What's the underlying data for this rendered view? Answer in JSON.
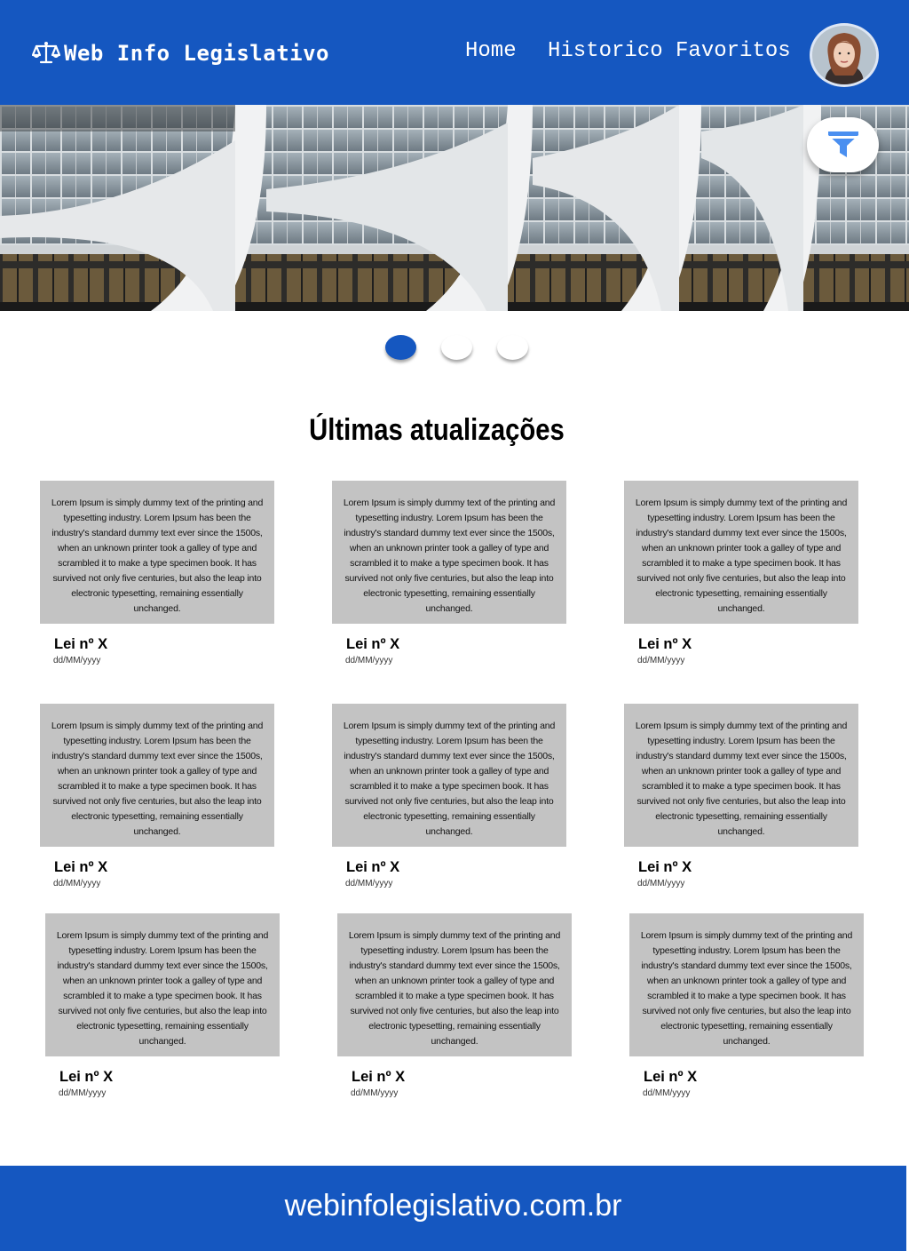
{
  "header": {
    "title": "Web Info Legislativo",
    "logo_icon": "scales-icon",
    "nav": {
      "home": "Home",
      "history": "Historico",
      "favorites": "Favoritos"
    },
    "avatar_icon": "user-avatar",
    "bg_color": "#1557c0"
  },
  "hero": {
    "filter_icon": "filter-icon"
  },
  "carousel": {
    "active_index": 0,
    "count": 3
  },
  "section": {
    "title": "Últimas atualizações"
  },
  "cards": [
    {
      "text": "Lorem Ipsum is simply dummy text of the printing and typesetting industry. Lorem Ipsum has been the industry's standard dummy text ever since the 1500s, when an unknown printer took a galley of type and scrambled it to make a type specimen book. It has survived not only five centuries, but also the leap into electronic typesetting, remaining essentially unchanged.",
      "title": "Lei nº X",
      "date": "dd/MM/yyyy"
    },
    {
      "text": "Lorem Ipsum is simply dummy text of the printing and typesetting industry. Lorem Ipsum has been the industry's standard dummy text ever since the 1500s, when an unknown printer took a galley of type and scrambled it to make a type specimen book. It has survived not only five centuries, but also the leap into electronic typesetting, remaining essentially unchanged.",
      "title": "Lei nº X",
      "date": "dd/MM/yyyy"
    },
    {
      "text": "Lorem Ipsum is simply dummy text of the printing and typesetting industry. Lorem Ipsum has been the industry's standard dummy text ever since the 1500s, when an unknown printer took a galley of type and scrambled it to make a type specimen book. It has survived not only five centuries, but also the leap into electronic typesetting, remaining essentially unchanged.",
      "title": "Lei nº X",
      "date": "dd/MM/yyyy"
    },
    {
      "text": "Lorem Ipsum is simply dummy text of the printing and typesetting industry. Lorem Ipsum has been the industry's standard dummy text ever since the 1500s, when an unknown printer took a galley of type and scrambled it to make a type specimen book. It has survived not only five centuries, but also the leap into electronic typesetting, remaining essentially unchanged.",
      "title": "Lei nº X",
      "date": "dd/MM/yyyy"
    },
    {
      "text": "Lorem Ipsum is simply dummy text of the printing and typesetting industry. Lorem Ipsum has been the industry's standard dummy text ever since the 1500s, when an unknown printer took a galley of type and scrambled it to make a type specimen book. It has survived not only five centuries, but also the leap into electronic typesetting, remaining essentially unchanged.",
      "title": "Lei nº X",
      "date": "dd/MM/yyyy"
    },
    {
      "text": "Lorem Ipsum is simply dummy text of the printing and typesetting industry. Lorem Ipsum has been the industry's standard dummy text ever since the 1500s, when an unknown printer took a galley of type and scrambled it to make a type specimen book. It has survived not only five centuries, but also the leap into electronic typesetting, remaining essentially unchanged.",
      "title": "Lei nº X",
      "date": "dd/MM/yyyy"
    },
    {
      "text": "Lorem Ipsum is simply dummy text of the printing and typesetting industry. Lorem Ipsum has been the industry's standard dummy text ever since the 1500s, when an unknown printer took a galley of type and scrambled it to make a type specimen book. It has survived not only five centuries, but also the leap into electronic typesetting, remaining essentially unchanged.",
      "title": "Lei nº X",
      "date": "dd/MM/yyyy"
    },
    {
      "text": "Lorem Ipsum is simply dummy text of the printing and typesetting industry. Lorem Ipsum has been the industry's standard dummy text ever since the 1500s, when an unknown printer took a galley of type and scrambled it to make a type specimen book. It has survived not only five centuries, but also the leap into electronic typesetting, remaining essentially unchanged.",
      "title": "Lei nº X",
      "date": "dd/MM/yyyy"
    },
    {
      "text": "Lorem Ipsum is simply dummy text of the printing and typesetting industry. Lorem Ipsum has been the industry's standard dummy text ever since the 1500s, when an unknown printer took a galley of type and scrambled it to make a type specimen book. It has survived not only five centuries, but also the leap into electronic typesetting, remaining essentially unchanged.",
      "title": "Lei nº X",
      "date": "dd/MM/yyyy"
    }
  ],
  "footer": {
    "text": "webinfolegislativo.com.br",
    "bg_color": "#1557c0"
  }
}
